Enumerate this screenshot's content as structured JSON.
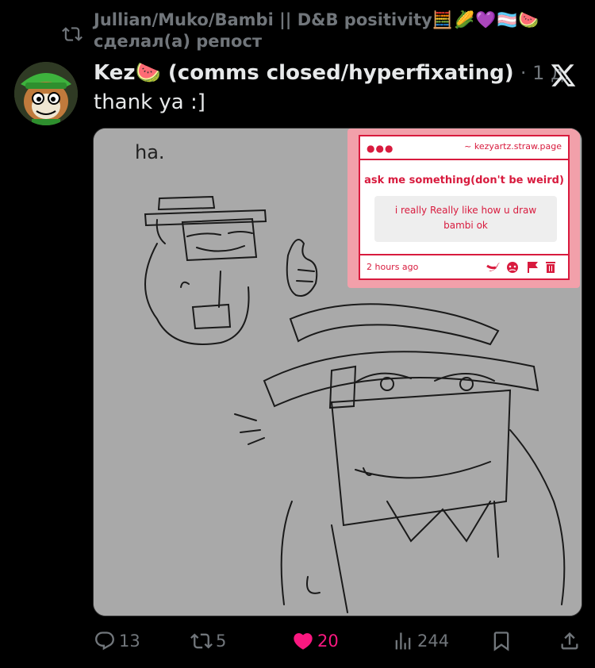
{
  "repost": {
    "line1": "Jullian/Muko/Bambi || D&B positivity",
    "emojis": "🧮🌽💜🏳️‍⚧️🍉",
    "line2": "сделал(а) репост"
  },
  "tweet": {
    "author": "Kez",
    "author_emoji": "🍉",
    "author_rest": "(comms closed/hyperfixating)",
    "time": "· 1 д.",
    "text": "thank ya :]"
  },
  "drawing": {
    "caption": "ha."
  },
  "ask_card": {
    "dots": "●●●",
    "site": "~ kezyartz.straw.page",
    "question": "ask me something(don't be weird)",
    "answer_line1": "i really Really like how u draw",
    "answer_line2": "bambi ok",
    "time": "2 hours ago",
    "icons": [
      "twitter-icon",
      "angry-face-icon",
      "flag-icon",
      "trash-icon"
    ]
  },
  "actions": {
    "replies": "13",
    "reposts": "5",
    "likes": "20",
    "views": "244"
  },
  "colors": {
    "like": "#f91880",
    "muted": "#71767b",
    "ask_red": "#d81b3e"
  }
}
